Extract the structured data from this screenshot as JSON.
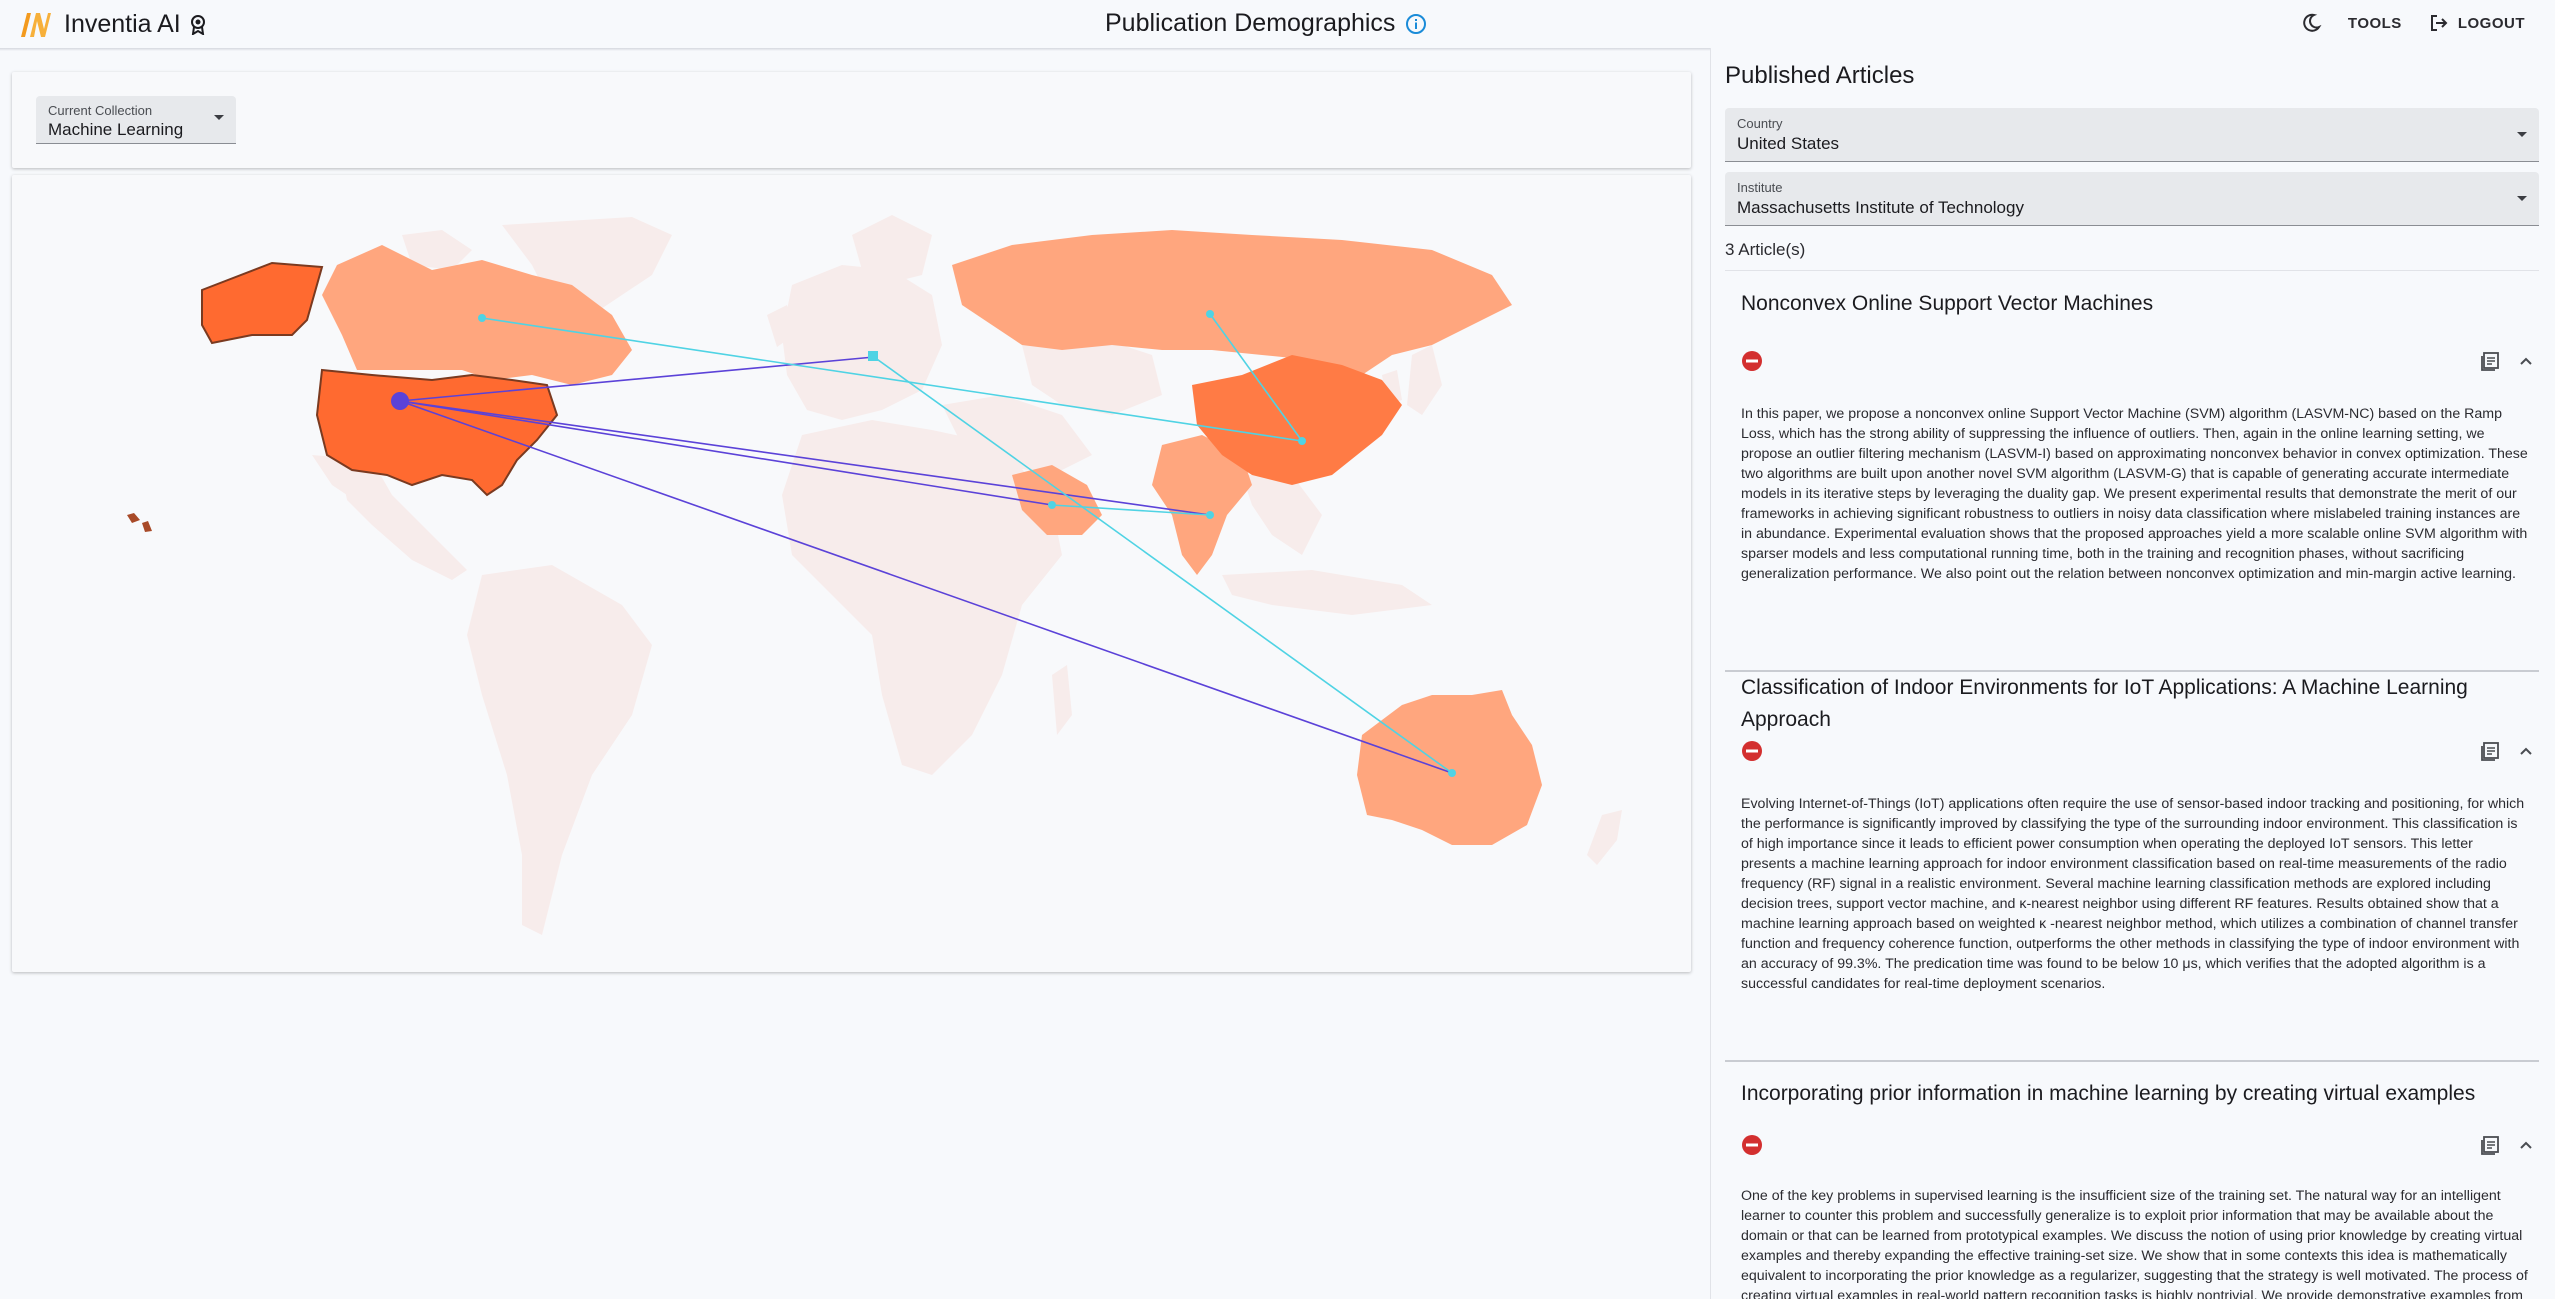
{
  "header": {
    "brand": "Inventia AI",
    "title": "Publication Demographics",
    "tools_label": "TOOLS",
    "logout_label": "LOGOUT"
  },
  "collection": {
    "label": "Current Collection",
    "value": "Machine Learning"
  },
  "map": {
    "highlight_color": "#ff6a30",
    "shade_color": "#ffa67e",
    "base_color": "#f7eceb",
    "link_color_selected": "#5b42d8",
    "link_color_other": "#4fd3e4"
  },
  "panel": {
    "title": "Published Articles",
    "country_label": "Country",
    "country_value": "United States",
    "institute_label": "Institute",
    "institute_value": "Massachusetts Institute of Technology",
    "count": "3 Article(s)"
  },
  "articles": [
    {
      "title": "Nonconvex Online Support Vector Machines",
      "abstract": "In this paper, we propose a nonconvex online Support Vector Machine (SVM) algorithm (LASVM-NC) based on the Ramp Loss, which has the strong ability of suppressing the influence of outliers. Then, again in the online learning setting, we propose an outlier filtering mechanism (LASVM-I) based on approximating nonconvex behavior in convex optimization. These two algorithms are built upon another novel SVM algorithm (LASVM-G) that is capable of generating accurate intermediate models in its iterative steps by leveraging the duality gap. We present experimental results that demonstrate the merit of our frameworks in achieving significant robustness to outliers in noisy data classification where mislabeled training instances are in abundance. Experimental evaluation shows that the proposed approaches yield a more scalable online SVM algorithm with sparser models and less computational running time, both in the training and recognition phases, without sacrificing generalization performance. We also point out the relation between nonconvex optimization and min-margin active learning."
    },
    {
      "title": "Classification of Indoor Environments for IoT Applications: A Machine Learning Approach",
      "abstract": "Evolving Internet-of-Things (IoT) applications often require the use of sensor-based indoor tracking and positioning, for which the performance is significantly improved by classifying the type of the surrounding indoor environment. This classification is of high importance since it leads to efficient power consumption when operating the deployed IoT sensors. This letter presents a machine learning approach for indoor environment classification based on real-time measurements of the radio frequency (RF) signal in a realistic environment. Several machine learning classification methods are explored including decision trees, support vector machine, and κ-nearest neighbor using different RF features. Results obtained show that a machine learning approach based on weighted κ -nearest neighbor method, which utilizes a combination of channel transfer function and frequency coherence function, outperforms the other methods in classifying the type of indoor environment with an accuracy of 99.3%. The predication time was found to be below 10 μs, which verifies that the adopted algorithm is a successful candidates for real-time deployment scenarios."
    },
    {
      "title": "Incorporating prior information in machine learning by creating virtual examples",
      "abstract": "One of the key problems in supervised learning is the insufficient size of the training set. The natural way for an intelligent learner to counter this problem and successfully generalize is to exploit prior information that may be available about the domain or that can be learned from prototypical examples. We discuss the notion of using prior knowledge by creating virtual examples and thereby expanding the effective training-set size. We show that in some contexts this idea is mathematically equivalent to incorporating the prior knowledge as a regularizer, suggesting that the strategy is well motivated. The process of creating virtual examples in real-world pattern recognition tasks is highly nontrivial. We provide demonstrative examples from object recognition and speech recognition to illustrate the idea."
    }
  ]
}
